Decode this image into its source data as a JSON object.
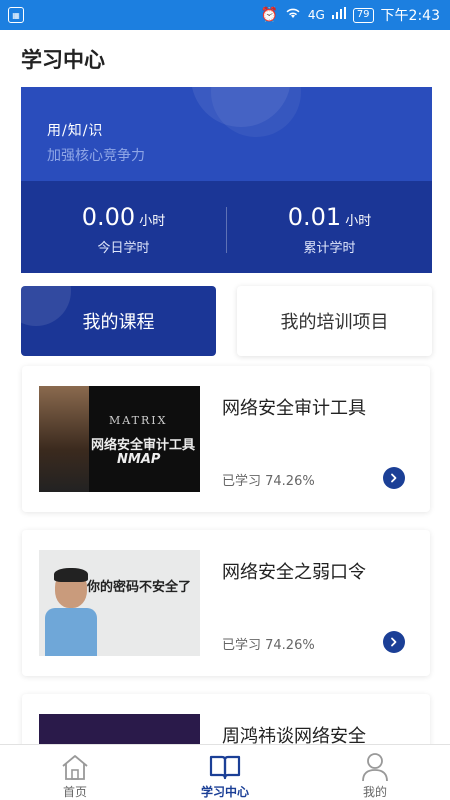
{
  "status_bar": {
    "battery": "79",
    "network": "4G",
    "time": "下午2:43"
  },
  "header": {
    "title": "学习中心"
  },
  "banner": {
    "slogan": "用/知/识",
    "subtitle": "加强核心竞争力",
    "stats": [
      {
        "value": "0.00",
        "unit": "小时",
        "label": "今日学时"
      },
      {
        "value": "0.01",
        "unit": "小时",
        "label": "累计学时"
      }
    ]
  },
  "tabs": [
    {
      "label": "我的课程",
      "active": true
    },
    {
      "label": "我的培训项目",
      "active": false
    }
  ],
  "courses": [
    {
      "title": "网络安全审计工具",
      "progress": "已学习 74.26%",
      "thumb_text": {
        "brand": "MATRIX",
        "line1": "网络安全审计工具",
        "line2": "NMAP"
      }
    },
    {
      "title": "网络安全之弱口令",
      "progress": "已学习 74.26%",
      "thumb_text": {
        "line1": "你的密码不安全了"
      }
    },
    {
      "title": "周鸿祎谈网络安全",
      "progress": "",
      "thumb_text": {}
    }
  ],
  "bottom_nav": [
    {
      "label": "首页",
      "icon": "home-icon",
      "active": false
    },
    {
      "label": "学习中心",
      "icon": "book-icon",
      "active": true
    },
    {
      "label": "我的",
      "icon": "person-icon",
      "active": false
    }
  ],
  "colors": {
    "status_bar": "#1c7fe0",
    "brand_dark": "#1b3696",
    "accent": "#1b3f96"
  }
}
